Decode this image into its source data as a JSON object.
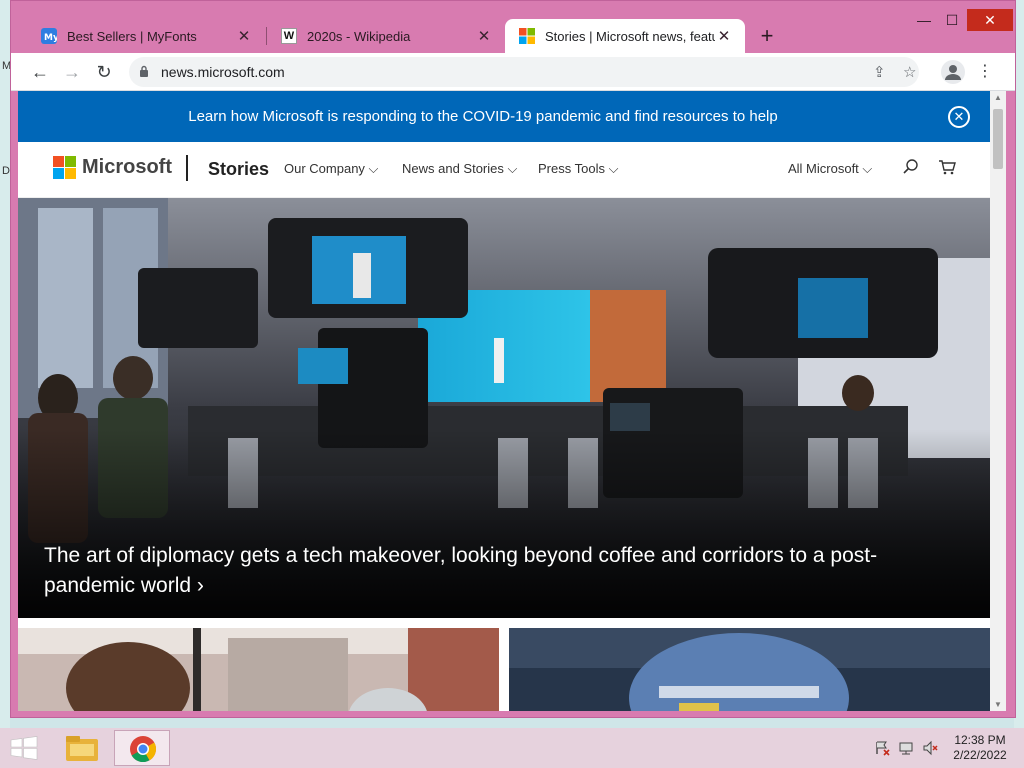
{
  "desktop": {
    "left_glyphs": [
      "M",
      "D"
    ]
  },
  "tabs": [
    {
      "title": "Best Sellers | MyFonts",
      "favicon": "myfonts-icon"
    },
    {
      "title": "2020s - Wikipedia",
      "favicon": "wikipedia-icon",
      "favicon_text": "W"
    },
    {
      "title": "Stories | Microsoft news, features",
      "favicon": "microsoft-icon"
    }
  ],
  "new_tab_label": "+",
  "window_controls": {
    "minimize": "—",
    "maximize": "☐",
    "close": "✕"
  },
  "toolbar": {
    "back": "←",
    "forward": "→",
    "reload": "↻",
    "url": "news.microsoft.com",
    "share": "⇪",
    "bookmark": "☆",
    "menu": "⋮"
  },
  "page": {
    "banner": {
      "message": "Learn how Microsoft is responding to the COVID-19 pandemic and find resources to help",
      "close": "✕"
    },
    "nav": {
      "brand": "Microsoft",
      "section": "Stories",
      "items": [
        "Our Company ⌵",
        "News and Stories ⌵",
        "Press Tools ⌵"
      ],
      "all_microsoft": "All Microsoft ⌵",
      "search_glyph": "⚲",
      "cart_glyph": "🛒"
    },
    "hero": {
      "caption": "The art of diplomacy gets a tech makeover, looking beyond coffee and corridors to a post-pandemic world ›"
    }
  },
  "taskbar": {
    "time": "12:38 PM",
    "date": "2/22/2022"
  },
  "colors": {
    "window_frame": "#d87bb0",
    "banner": "#0067b8",
    "ms_red": "#f25022",
    "ms_green": "#7fba00",
    "ms_blue": "#00a4ef",
    "ms_yellow": "#ffb900"
  }
}
